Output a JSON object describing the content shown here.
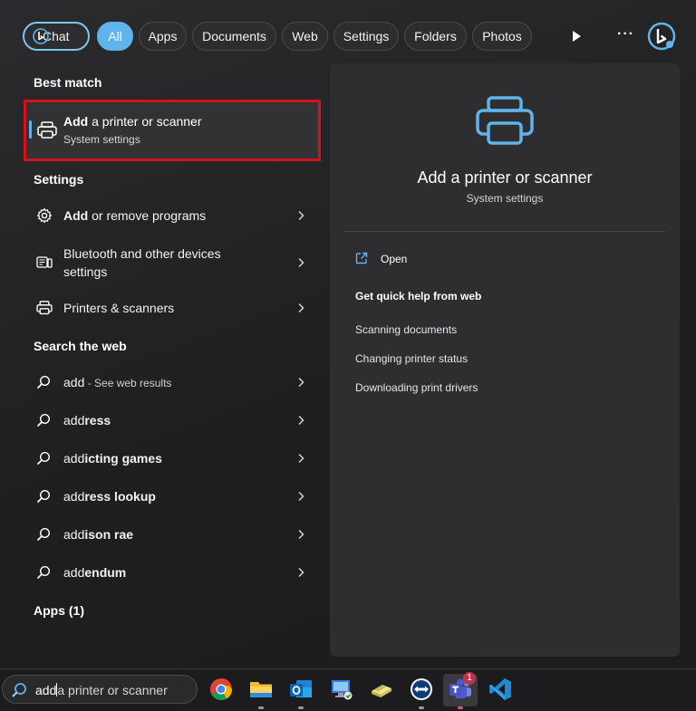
{
  "filters": {
    "chat": "Chat",
    "all": "All",
    "apps": "Apps",
    "documents": "Documents",
    "web": "Web",
    "settings": "Settings",
    "folders": "Folders",
    "photos": "Photos"
  },
  "toolbar": {
    "play_icon": "play-icon",
    "more": "···",
    "bing_icon": "bing-icon"
  },
  "best_match": {
    "heading": "Best match",
    "title_bold": "Add",
    "title_rest": " a printer or scanner",
    "subtitle": "System settings"
  },
  "settings_section": {
    "heading": "Settings",
    "items": [
      {
        "bold": "Add",
        "rest": " or remove programs",
        "icon": "gear-icon"
      },
      {
        "line1": "Bluetooth and other devices",
        "line2": "settings",
        "icon": "devices-icon"
      },
      {
        "text": "Printers & scanners",
        "icon": "printer-icon"
      }
    ]
  },
  "web_section": {
    "heading": "Search the web",
    "items": [
      {
        "prefix": "add",
        "suffix": " - See web results"
      },
      {
        "prefix": "add",
        "suffix": "ress"
      },
      {
        "prefix": "add",
        "suffix": "icting games"
      },
      {
        "prefix": "add",
        "suffix": "ress lookup"
      },
      {
        "prefix": "add",
        "suffix": "ison rae"
      },
      {
        "prefix": "add",
        "suffix": "endum"
      }
    ]
  },
  "apps_section": {
    "heading": "Apps (1)"
  },
  "preview": {
    "title": "Add a printer or scanner",
    "subtitle": "System settings",
    "open": "Open",
    "help_heading": "Get quick help from web",
    "help_links": [
      "Scanning documents",
      "Changing printer status",
      "Downloading print drivers"
    ]
  },
  "taskbar": {
    "query_typed": "add",
    "query_suggest": "a printer or scanner",
    "apps": [
      "chrome",
      "file-explorer",
      "outlook",
      "remote-desktop",
      "notes",
      "teamviewer",
      "teams",
      "vscode"
    ],
    "teams_badge": "1"
  },
  "colors": {
    "accent": "#60b4ec",
    "highlight_border": "#d4121a"
  }
}
